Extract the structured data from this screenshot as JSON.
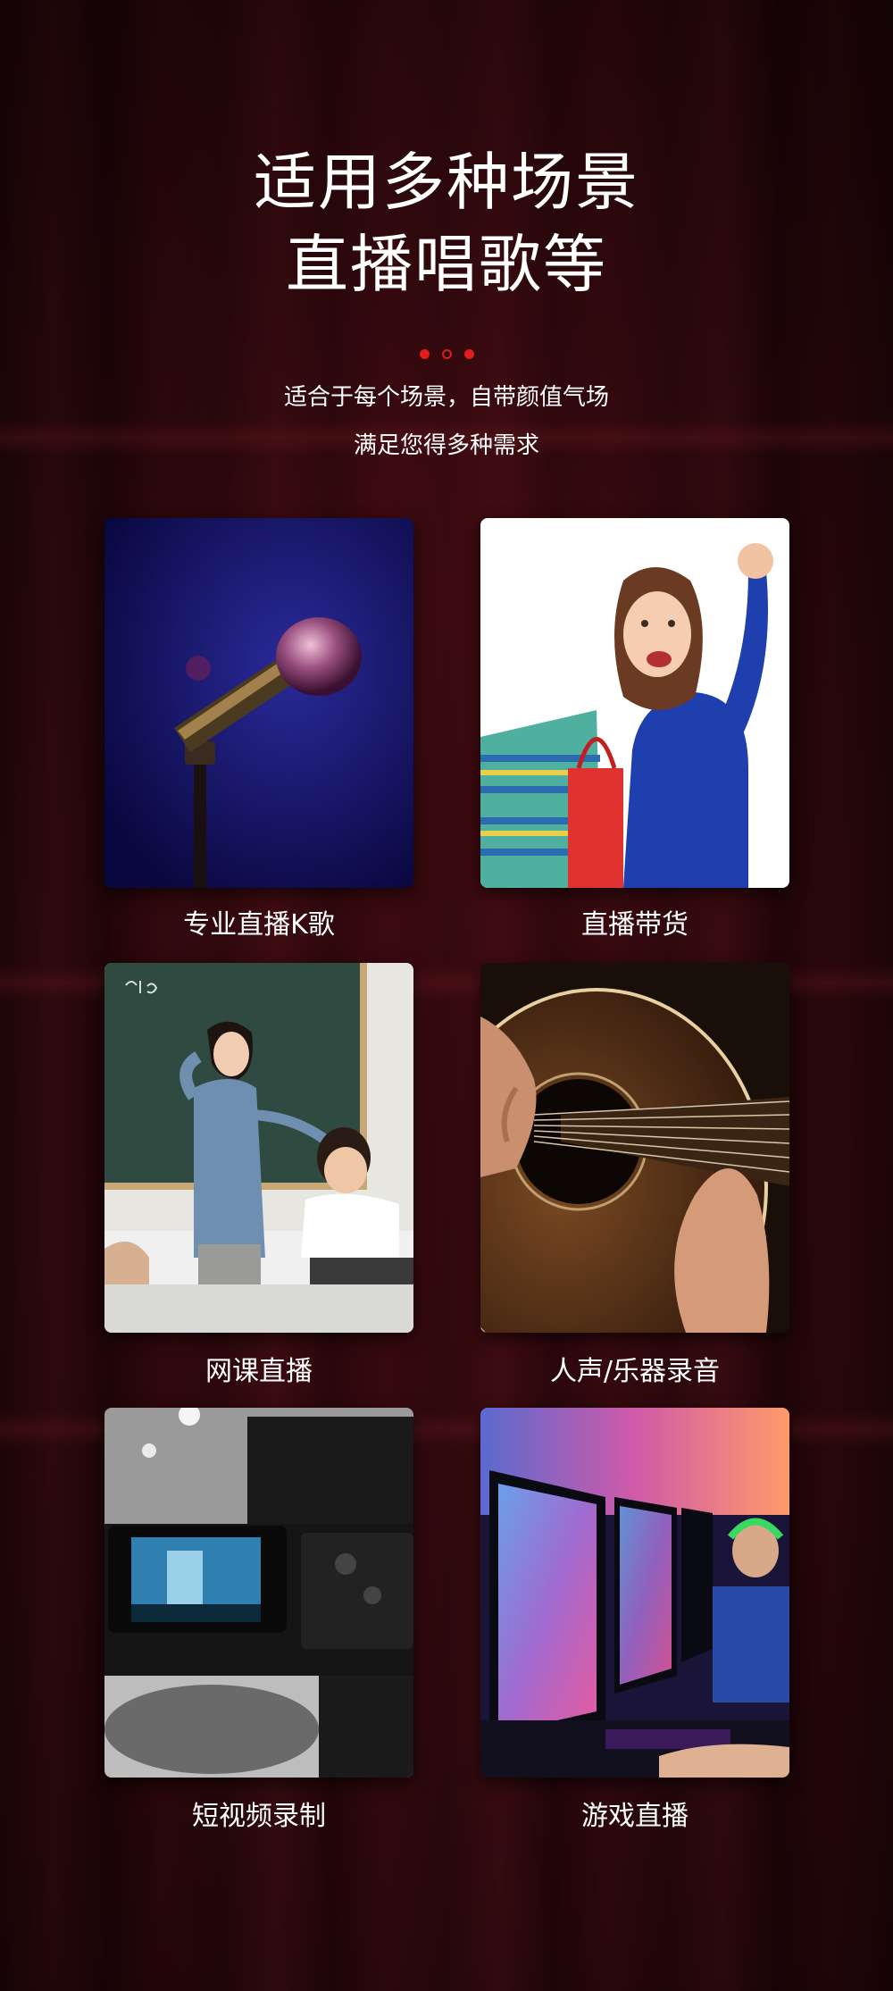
{
  "header": {
    "title_line1": "适用多种场景",
    "title_line2": "直播唱歌等",
    "subtitle_line1": "适合于每个场景，自带颜值气场",
    "subtitle_line2": "满足您得多种需求"
  },
  "colors": {
    "accent": "#e31b1b",
    "background": "#2a080b",
    "text": "#ffffff"
  },
  "scenes": [
    {
      "label": "专业直播K歌",
      "image": "microphone-on-stage"
    },
    {
      "label": "直播带货",
      "image": "woman-with-shopping-bags"
    },
    {
      "label": "网课直播",
      "image": "teacher-at-blackboard"
    },
    {
      "label": "人声/乐器录音",
      "image": "acoustic-guitar"
    },
    {
      "label": "短视频录制",
      "image": "video-camera"
    },
    {
      "label": "游戏直播",
      "image": "gaming-monitors"
    }
  ]
}
